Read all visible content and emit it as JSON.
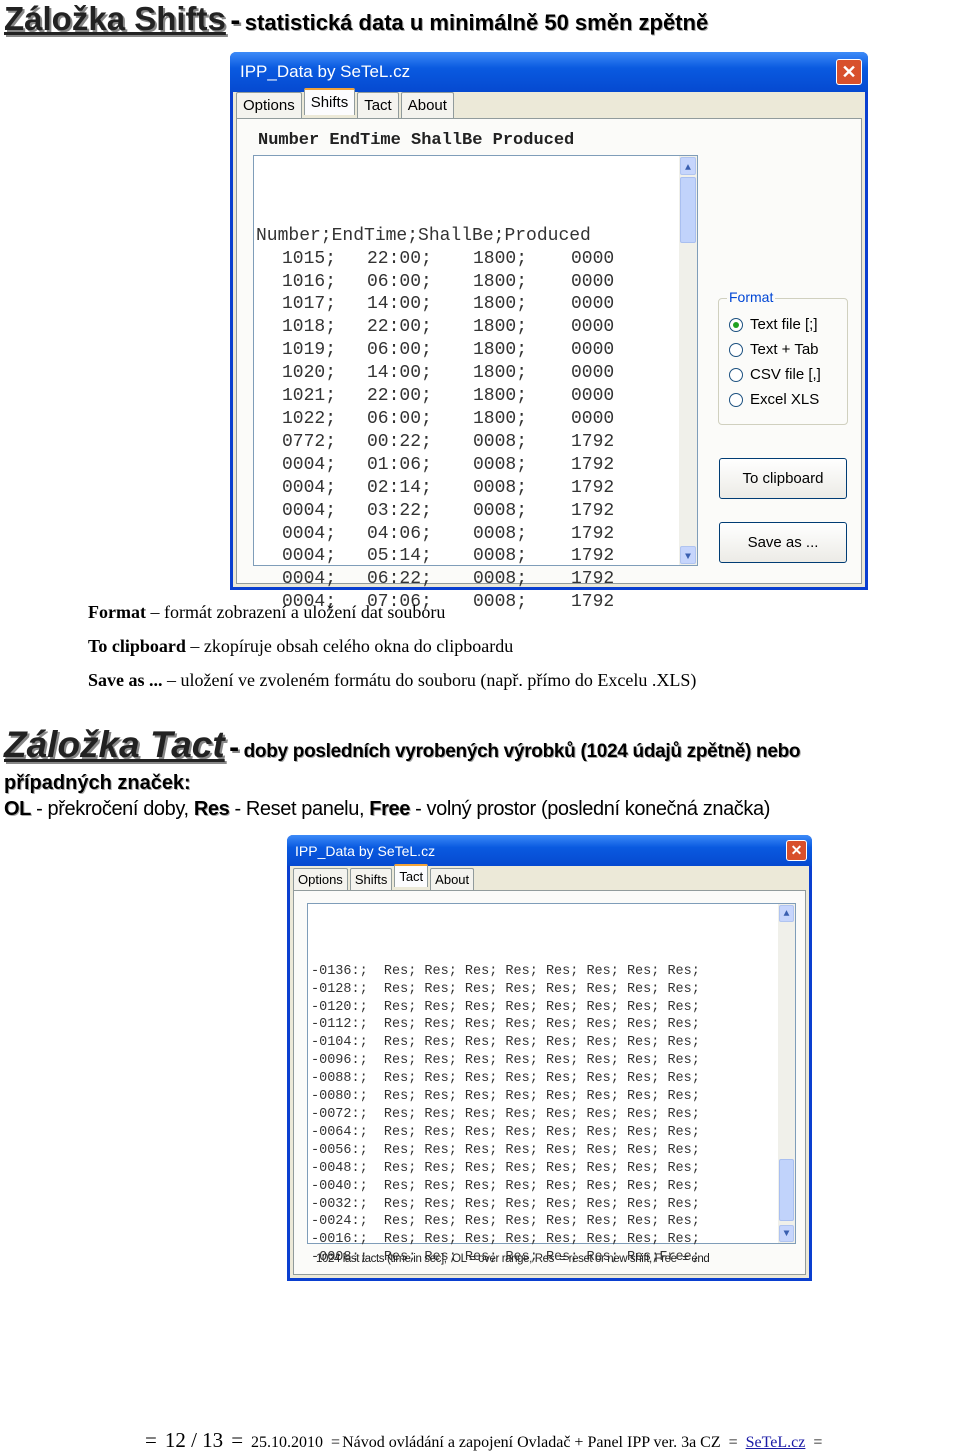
{
  "heading1": {
    "title": "Záložka Shifts",
    "dash": "-",
    "subtitle": "statistická data u minimálně 50 směn zpětně"
  },
  "window1": {
    "title": "IPP_Data by SeTeL.cz",
    "tabs": [
      "Options",
      "Shifts",
      "Tact",
      "About"
    ],
    "active_tab": "Shifts",
    "header_label": "Number EndTime ShallBe Produced",
    "list_header": "Number;EndTime;ShallBe;Produced",
    "rows": [
      [
        "1015",
        "22:00",
        "1800",
        "0000"
      ],
      [
        "1016",
        "06:00",
        "1800",
        "0000"
      ],
      [
        "1017",
        "14:00",
        "1800",
        "0000"
      ],
      [
        "1018",
        "22:00",
        "1800",
        "0000"
      ],
      [
        "1019",
        "06:00",
        "1800",
        "0000"
      ],
      [
        "1020",
        "14:00",
        "1800",
        "0000"
      ],
      [
        "1021",
        "22:00",
        "1800",
        "0000"
      ],
      [
        "1022",
        "06:00",
        "1800",
        "0000"
      ],
      [
        "0772",
        "00:22",
        "0008",
        "1792"
      ],
      [
        "0004",
        "01:06",
        "0008",
        "1792"
      ],
      [
        "0004",
        "02:14",
        "0008",
        "1792"
      ],
      [
        "0004",
        "03:22",
        "0008",
        "1792"
      ],
      [
        "0004",
        "04:06",
        "0008",
        "1792"
      ],
      [
        "0004",
        "05:14",
        "0008",
        "1792"
      ],
      [
        "0004",
        "06:22",
        "0008",
        "1792"
      ],
      [
        "0004",
        "07:06",
        "0008",
        "1792"
      ]
    ],
    "format": {
      "label": "Format",
      "options": [
        "Text file [;]",
        "Text + Tab",
        "CSV file [,]",
        "Excel XLS"
      ],
      "selected": "Text file [;]"
    },
    "to_clipboard": "To clipboard",
    "save_as": "Save as ..."
  },
  "descriptions": [
    {
      "term": "Format",
      "text": " – formát zobrazení a uložení dat souboru"
    },
    {
      "term": "To clipboard",
      "text": " – zkopíruje obsah celého okna do clipboardu"
    },
    {
      "term": "Save as ...",
      "text": " – uložení ve zvoleném formátu do souboru (např. přímo do Excelu .XLS)"
    }
  ],
  "heading2": {
    "title": "Záložka Tact",
    "dash": "-",
    "subtitle": "doby posledních vyrobených výrobků (1024 údajů zpětně) nebo",
    "subtitle2": "případných značek:",
    "legend": [
      {
        "term": "OL",
        "text": " - překročení doby, "
      },
      {
        "term": "Res",
        "text": " - Reset panelu, "
      },
      {
        "term": "Free",
        "text": " - volný prostor (poslední konečná značka)"
      }
    ]
  },
  "window2": {
    "title": "IPP_Data by SeTeL.cz",
    "tabs": [
      "Options",
      "Shifts",
      "Tact",
      "About"
    ],
    "active_tab": "Tact",
    "rows": [
      "-0136:;  Res; Res; Res; Res; Res; Res; Res; Res;",
      "-0128:;  Res; Res; Res; Res; Res; Res; Res; Res;",
      "-0120:;  Res; Res; Res; Res; Res; Res; Res; Res;",
      "-0112:;  Res; Res; Res; Res; Res; Res; Res; Res;",
      "-0104:;  Res; Res; Res; Res; Res; Res; Res; Res;",
      "-0096:;  Res; Res; Res; Res; Res; Res; Res; Res;",
      "-0088:;  Res; Res; Res; Res; Res; Res; Res; Res;",
      "-0080:;  Res; Res; Res; Res; Res; Res; Res; Res;",
      "-0072:;  Res; Res; Res; Res; Res; Res; Res; Res;",
      "-0064:;  Res; Res; Res; Res; Res; Res; Res; Res;",
      "-0056:;  Res; Res; Res; Res; Res; Res; Res; Res;",
      "-0048:;  Res; Res; Res; Res; Res; Res; Res; Res;",
      "-0040:;  Res; Res; Res; Res; Res; Res; Res; Res;",
      "-0032:;  Res; Res; Res; Res; Res; Res; Res; Res;",
      "-0024:;  Res; Res; Res; Res; Res; Res; Res; Res;",
      "-0016:;  Res; Res; Res; Res; Res; Res; Res; Res;",
      "-0008:;  Res; Res; Res; Res; Res; Res; Res;Free;"
    ],
    "status": "1024 last tacts (time in sec],  OL = over range, Res  = reset or new shift, Free  = end"
  },
  "footer": {
    "page": "12 / 13",
    "date": "25.10.2010",
    "doc": "Návod ovládání a zapojení Ovladač + Panel IPP ver. 3a CZ",
    "link": "SeTeL.cz",
    "sep": "="
  },
  "colors": {
    "titlebar": "#0a5ae0",
    "window_border": "#0a3fd0",
    "close": "#d8502c",
    "link": "#1a1aa6"
  }
}
